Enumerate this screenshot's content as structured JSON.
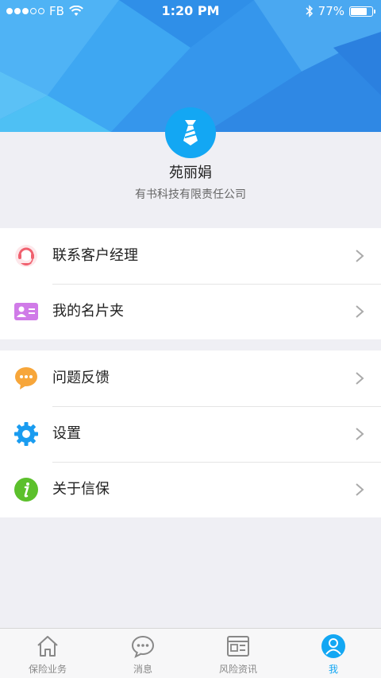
{
  "status_bar": {
    "carrier": "FB",
    "time": "1:20 PM",
    "battery": "77%",
    "battery_level": 0.77
  },
  "profile": {
    "name": "苑丽娟",
    "company": "有书科技有限责任公司",
    "avatar_icon": "tie-icon",
    "avatar_color": "#13a7f3"
  },
  "menu": {
    "group1": [
      {
        "label": "联系客户经理",
        "icon": "customer-service-icon"
      },
      {
        "label": "我的名片夹",
        "icon": "business-card-icon"
      }
    ],
    "group2": [
      {
        "label": "问题反馈",
        "icon": "chat-bubble-icon"
      },
      {
        "label": "设置",
        "icon": "gear-icon"
      },
      {
        "label": "关于信保",
        "icon": "info-icon"
      }
    ]
  },
  "tabbar": {
    "tabs": [
      {
        "label": "保险业务",
        "icon": "home-icon",
        "active": false
      },
      {
        "label": "消息",
        "icon": "message-icon",
        "active": false
      },
      {
        "label": "风险资讯",
        "icon": "news-icon",
        "active": false
      },
      {
        "label": "我",
        "icon": "profile-icon",
        "active": true
      }
    ],
    "active_color": "#13a7f3"
  }
}
